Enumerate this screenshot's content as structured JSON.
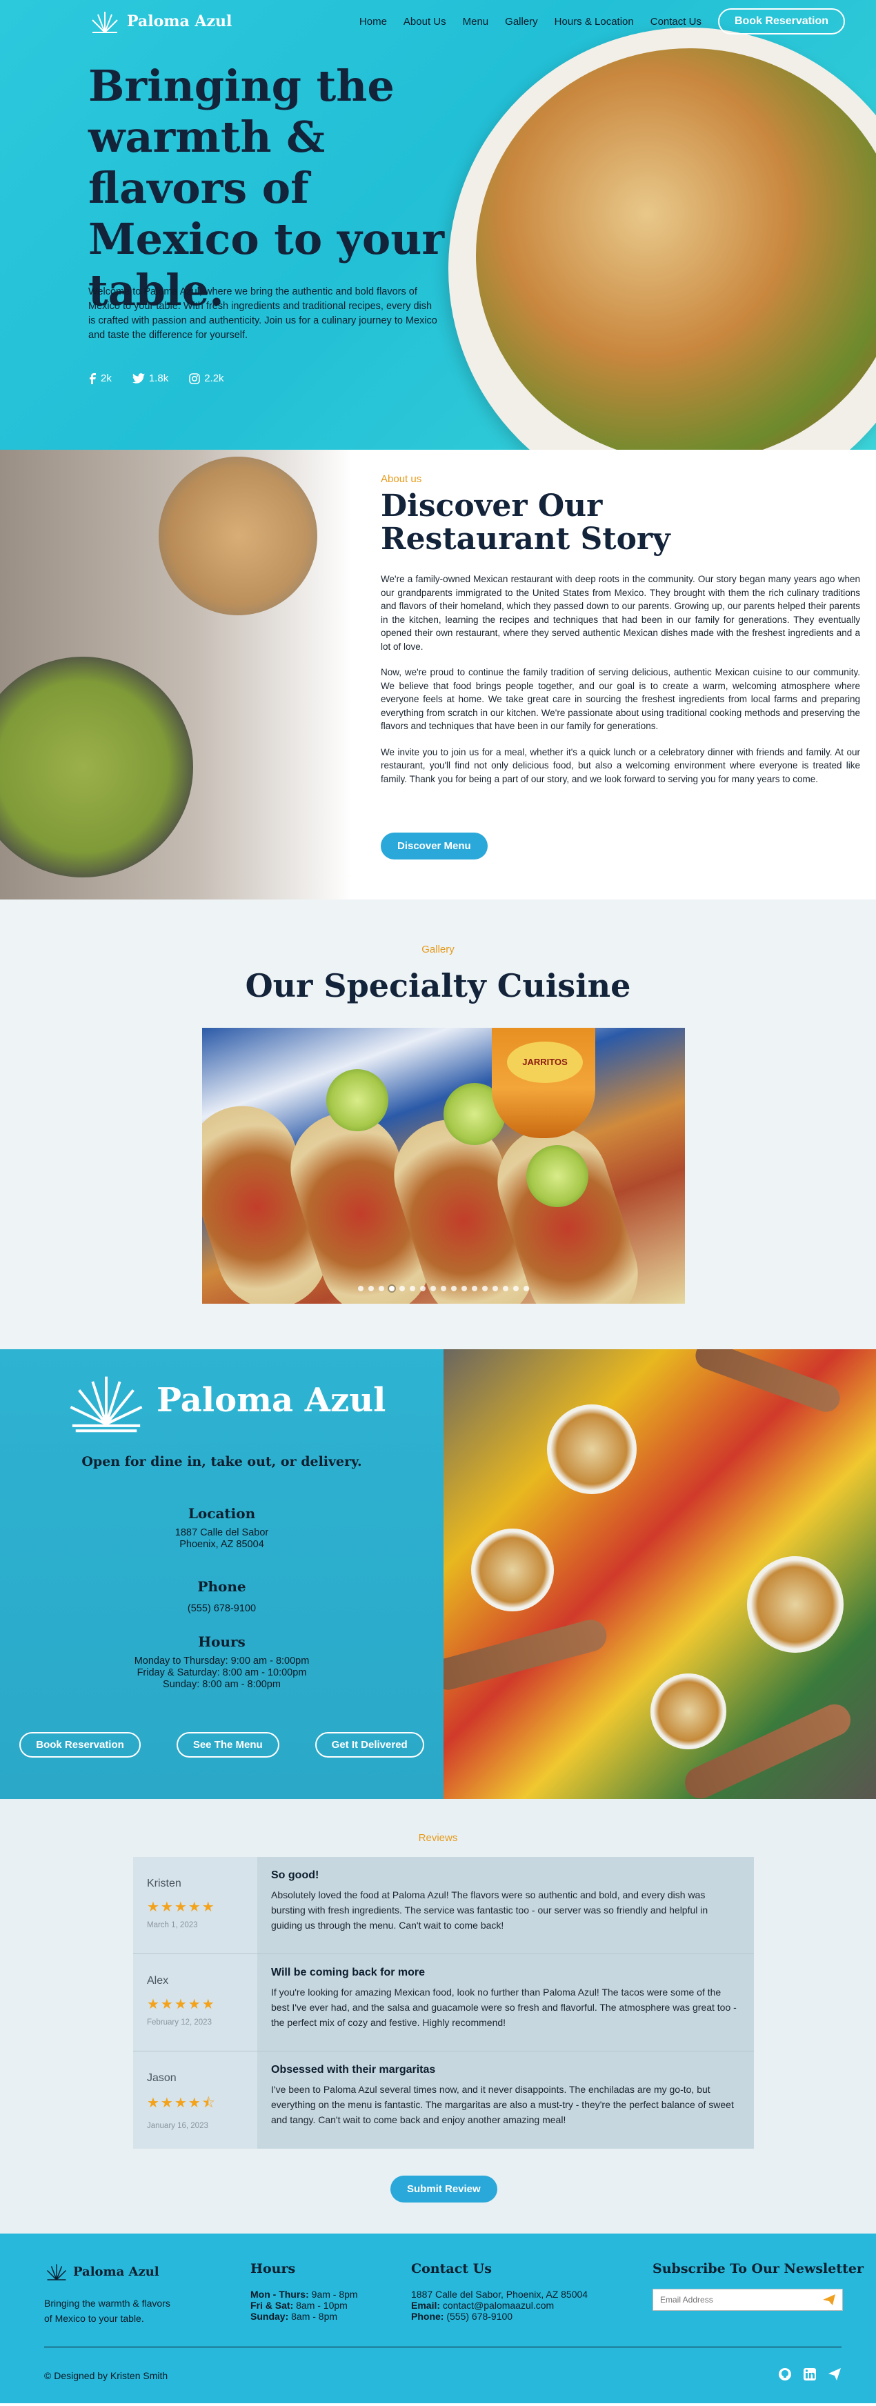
{
  "brand": {
    "name": "Paloma Azul"
  },
  "nav": {
    "links": [
      "Home",
      "About Us",
      "Menu",
      "Gallery",
      "Hours & Location",
      "Contact Us"
    ],
    "book_label": "Book Reservation"
  },
  "hero": {
    "title": "Bringing the warmth & flavors of Mexico to your table.",
    "text": "Welcome to Paloma Azul, where we bring the authentic and bold flavors of Mexico to your table. With fresh ingredients and traditional recipes, every dish is crafted with passion and authenticity. Join us for a culinary journey to Mexico and taste the difference for yourself.",
    "socials": [
      {
        "icon": "facebook-icon",
        "count": "2k"
      },
      {
        "icon": "twitter-icon",
        "count": "1.8k"
      },
      {
        "icon": "instagram-icon",
        "count": "2.2k"
      }
    ]
  },
  "about": {
    "eyebrow": "About us",
    "title": "Discover Our Restaurant Story",
    "paragraphs": [
      "We're a family-owned Mexican restaurant with deep roots in the community. Our story began many years ago when our grandparents immigrated to the United States from Mexico. They brought with them the rich culinary traditions and flavors of their homeland, which they passed down to our parents. Growing up, our parents helped their parents in the kitchen, learning the recipes and techniques that had been in our family for generations. They eventually opened their own restaurant, where they served authentic Mexican dishes made with the freshest ingredients and a lot of love.",
      "Now, we're proud to continue the family tradition of serving delicious, authentic Mexican cuisine to our community. We believe that food brings people together, and our goal is to create a warm, welcoming atmosphere where everyone feels at home. We take great care in sourcing the freshest ingredients from local farms and preparing everything from scratch in our kitchen. We're passionate about using traditional cooking methods and preserving the flavors and techniques that have been in our family for generations.",
      "We invite you to join us for a meal, whether it's a quick lunch or a celebratory dinner with friends and family. At our restaurant, you'll find not only delicious food, but also a welcoming environment where everyone is treated like family. Thank you for being a part of our story, and we look forward to serving you for many years to come."
    ],
    "button": "Discover Menu"
  },
  "gallery": {
    "eyebrow": "Gallery",
    "title": "Our Specialty Cuisine",
    "bottle_label": "JARRITOS",
    "dot_count": 17,
    "active_dot": 3
  },
  "info": {
    "brand_name": "Paloma Azul",
    "tagline": "Open for dine in, take out, or delivery.",
    "location_heading": "Location",
    "address_line1": "1887 Calle del Sabor",
    "address_line2": "Phoenix, AZ 85004",
    "phone_heading": "Phone",
    "phone": "(555) 678-9100",
    "hours_heading": "Hours",
    "hours_line1": "Monday to Thursday: 9:00 am - 8:00pm",
    "hours_line2": "Friday & Saturday: 8:00 am - 10:00pm",
    "hours_line3": "Sunday: 8:00 am - 8:00pm",
    "buttons": [
      "Book Reservation",
      "See The Menu",
      "Get It Delivered"
    ]
  },
  "reviews": {
    "eyebrow": "Reviews",
    "items": [
      {
        "name": "Kristen",
        "stars": "★★★★★",
        "rating": 5,
        "date": "March 1, 2023",
        "title": "So good!",
        "text": "Absolutely loved the food at Paloma Azul! The flavors were so authentic and bold, and every dish was bursting with fresh ingredients. The service was fantastic too - our server was so friendly and helpful in guiding us through the menu. Can't wait to come back!"
      },
      {
        "name": "Alex",
        "stars": "★★★★★",
        "rating": 5,
        "date": "February 12, 2023",
        "title": "Will be coming back for more",
        "text": "If you're looking for amazing Mexican food, look no further than Paloma Azul! The tacos were some of the best I've ever had, and the salsa and guacamole were so fresh and flavorful. The atmosphere was great too - the perfect mix of cozy and festive. Highly recommend!"
      },
      {
        "name": "Jason",
        "stars": "★★★★⯪",
        "rating": 4.5,
        "date": "January 16, 2023",
        "title": "Obsessed with their margaritas",
        "text": "I've been to Paloma Azul several times now, and it never disappoints. The enchiladas are my go-to, but everything on the menu is fantastic. The margaritas are also a must-try - they're the perfect balance of sweet and tangy. Can't wait to come back and enjoy another amazing meal!"
      }
    ],
    "button": "Submit Review"
  },
  "footer": {
    "brand_name": "Paloma Azul",
    "tagline": "Bringing the warmth & flavors of Mexico to your table.",
    "hours_heading": "Hours",
    "hours": [
      {
        "days": "Mon - Thurs:",
        "time": " 9am - 8pm"
      },
      {
        "days": "Fri & Sat:",
        "time": " 8am - 10pm"
      },
      {
        "days": "Sunday:",
        "time": " 8am - 8pm"
      }
    ],
    "contact_heading": "Contact Us",
    "contact_address": "1887 Calle del Sabor, Phoenix, AZ 85004",
    "email_label": "Email:",
    "email": " contact@palomaazul.com",
    "phone_label": "Phone:",
    "phone": " (555) 678-9100",
    "newsletter_heading": "Subscribe To Our Newsletter",
    "newsletter_placeholder": "Email Address",
    "copyright": "© Designed by Kristen Smith",
    "icons": [
      "github-icon",
      "linkedin-icon",
      "send-icon"
    ]
  },
  "colors": {
    "accent": "#2aa8d9",
    "hero_bg": "#22bfd6",
    "eyebrow": "#e69b1a",
    "star": "#f3a21a",
    "dark_text": "#13233a"
  }
}
